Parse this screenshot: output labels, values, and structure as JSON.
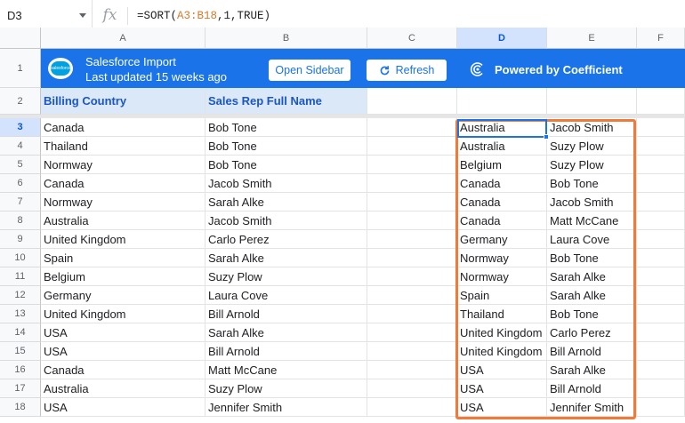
{
  "formula_bar": {
    "name_box": "D3",
    "fx": "fx",
    "formula_prefix": "=SORT(",
    "formula_range": "A3:B18",
    "formula_suffix": ",1,TRUE)"
  },
  "columns": [
    "A",
    "B",
    "C",
    "D",
    "E",
    "F"
  ],
  "row_numbers": [
    "1",
    "2",
    "3",
    "4",
    "5",
    "6",
    "7",
    "8",
    "9",
    "10",
    "11",
    "12",
    "13",
    "14",
    "15",
    "16",
    "17",
    "18"
  ],
  "banner": {
    "logo_text": "salesforce",
    "title": "Salesforce Import",
    "subtitle": "Last updated 15 weeks ago",
    "open_sidebar": "Open Sidebar",
    "refresh": "Refresh",
    "powered": "Powered by Coefficient",
    "color": "#1a73e8"
  },
  "headers": {
    "a": "Billing Country",
    "b": "Sales Rep Full Name"
  },
  "rows_ab": [
    [
      "Canada",
      "Bob Tone"
    ],
    [
      "Thailand",
      "Bob Tone"
    ],
    [
      "Normway",
      "Bob Tone"
    ],
    [
      "Canada",
      "Jacob Smith"
    ],
    [
      "Normway",
      "Sarah Alke"
    ],
    [
      "Australia",
      "Jacob Smith"
    ],
    [
      "United Kingdom",
      "Carlo Perez"
    ],
    [
      "Spain",
      "Sarah Alke"
    ],
    [
      "Belgium",
      "Suzy Plow"
    ],
    [
      "Germany",
      "Laura Cove"
    ],
    [
      "United Kingdom",
      "Bill Arnold"
    ],
    [
      "USA",
      "Sarah Alke"
    ],
    [
      "USA",
      "Bill Arnold"
    ],
    [
      "Canada",
      "Matt McCane"
    ],
    [
      "Australia",
      "Suzy Plow"
    ],
    [
      "USA",
      "Jennifer Smith"
    ]
  ],
  "rows_de": [
    [
      "Australia",
      "Jacob Smith"
    ],
    [
      "Australia",
      "Suzy Plow"
    ],
    [
      "Belgium",
      "Suzy Plow"
    ],
    [
      "Canada",
      "Bob Tone"
    ],
    [
      "Canada",
      "Jacob Smith"
    ],
    [
      "Canada",
      "Matt McCane"
    ],
    [
      "Germany",
      "Laura Cove"
    ],
    [
      "Normway",
      "Bob Tone"
    ],
    [
      "Normway",
      "Sarah Alke"
    ],
    [
      "Spain",
      "Sarah Alke"
    ],
    [
      "Thailand",
      "Bob Tone"
    ],
    [
      "United Kingdom",
      "Carlo Perez"
    ],
    [
      "United Kingdom",
      "Bill Arnold"
    ],
    [
      "USA",
      "Sarah Alke"
    ],
    [
      "USA",
      "Bill Arnold"
    ],
    [
      "USA",
      "Jennifer Smith"
    ]
  ],
  "colors": {
    "selection_outline": "#f07a3a",
    "header_fill": "#dbe8f8",
    "header_text": "#1a56c4"
  }
}
